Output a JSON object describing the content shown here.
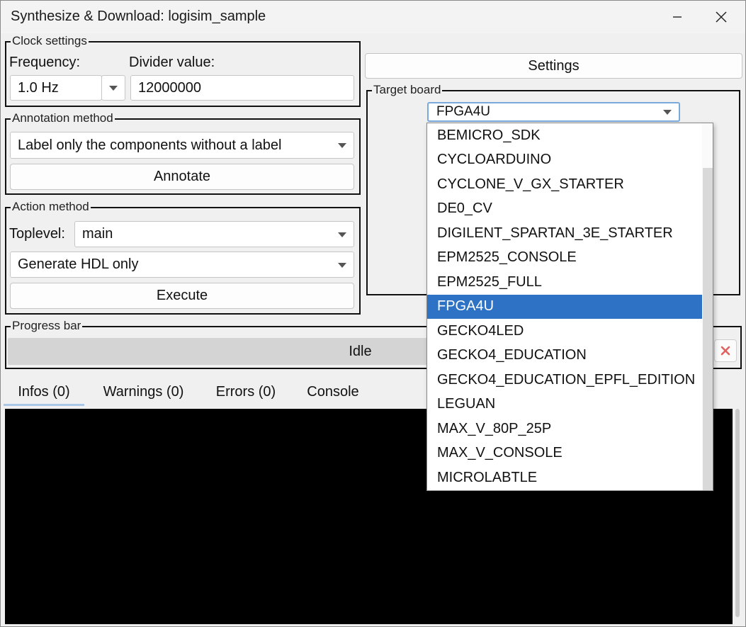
{
  "window": {
    "title": "Synthesize & Download: logisim_sample"
  },
  "clock": {
    "legend": "Clock settings",
    "frequency_label": "Frequency:",
    "frequency_value": "1.0 Hz",
    "divider_label": "Divider value:",
    "divider_value": "12000000"
  },
  "annotation": {
    "legend": "Annotation method",
    "method_value": "Label only the components without a label",
    "annotate_label": "Annotate"
  },
  "action": {
    "legend": "Action method",
    "toplevel_label": "Toplevel:",
    "toplevel_value": "main",
    "action_value": "Generate HDL only",
    "execute_label": "Execute"
  },
  "settings_label": "Settings",
  "target": {
    "legend": "Target board",
    "selected": "FPGA4U",
    "options": [
      "BEMICRO_SDK",
      "CYCLOARDUINO",
      "CYCLONE_V_GX_STARTER",
      "DE0_CV",
      "DIGILENT_SPARTAN_3E_STARTER",
      "EPM2525_CONSOLE",
      "EPM2525_FULL",
      "FPGA4U",
      "GECKO4LED",
      "GECKO4_EDUCATION",
      "GECKO4_EDUCATION_EPFL_EDITION",
      "LEGUAN",
      "MAX_V_80P_25P",
      "MAX_V_CONSOLE",
      "MICROLABTLE"
    ],
    "selected_index": 7
  },
  "progress": {
    "legend": "Progress bar",
    "status": "Idle"
  },
  "tabs": [
    {
      "label": "Infos (0)"
    },
    {
      "label": "Warnings (0)"
    },
    {
      "label": "Errors (0)"
    },
    {
      "label": "Console"
    }
  ],
  "colors": {
    "selection": "#2d72c4",
    "active_tab_underline": "#aac7e8",
    "focus_border": "#7aa9dc",
    "cancel_icon": "#e06060"
  },
  "icons": {
    "minimize": "minimize-icon",
    "close": "close-icon",
    "dropdown": "chevron-down-icon",
    "cancel": "cancel-x-icon"
  }
}
